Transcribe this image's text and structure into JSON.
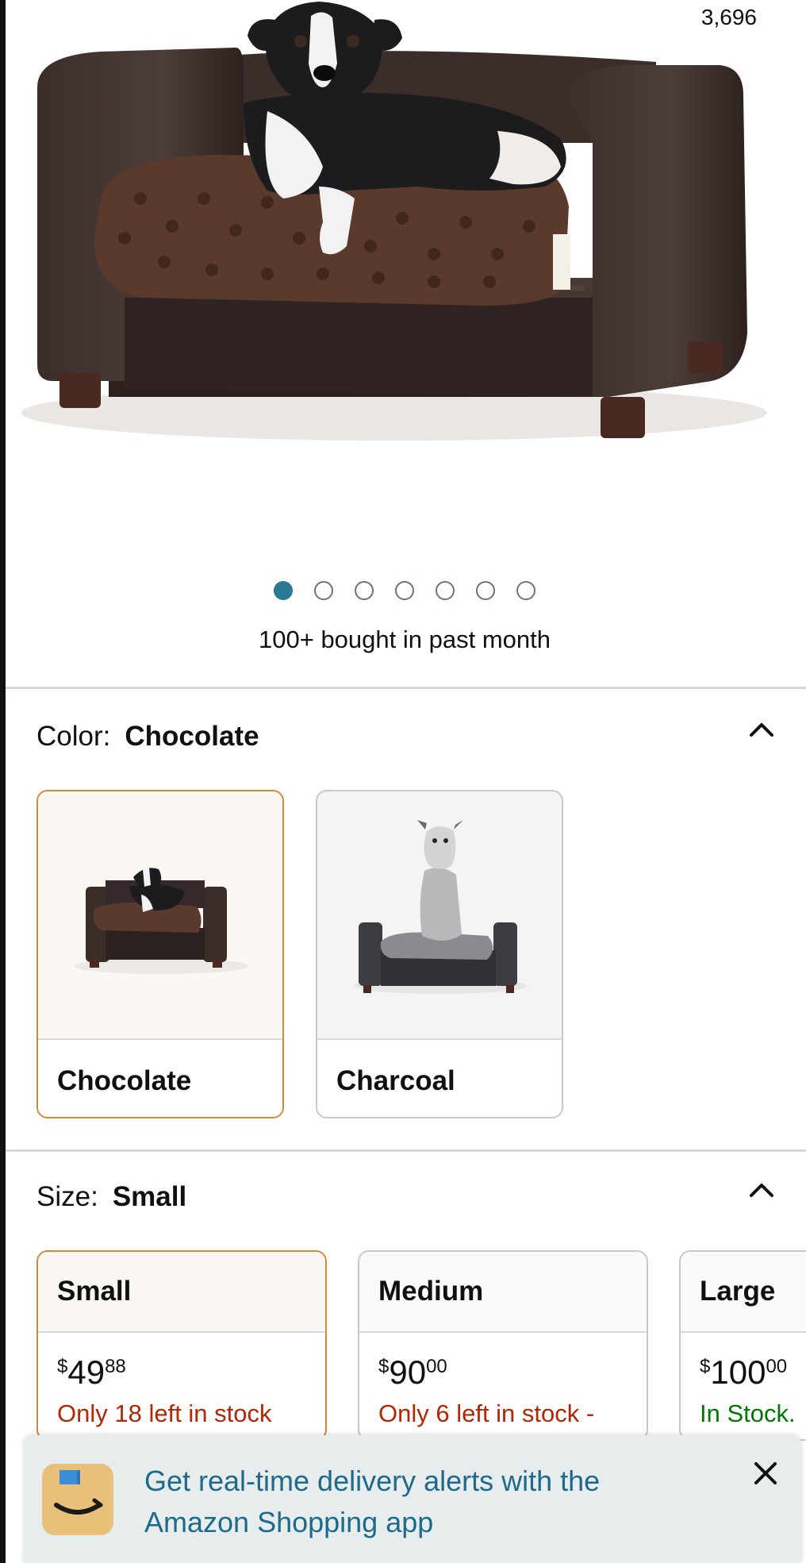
{
  "header": {
    "rating_count": "3,696"
  },
  "gallery": {
    "image_count": 7,
    "active_index": 0,
    "bought_text": "100+ bought in past month"
  },
  "color": {
    "label": "Color:",
    "selected": "Chocolate",
    "options": [
      {
        "name": "Chocolate",
        "selected": true
      },
      {
        "name": "Charcoal",
        "selected": false
      }
    ]
  },
  "size": {
    "label": "Size:",
    "selected": "Small",
    "options": [
      {
        "name": "Small",
        "currency": "$",
        "whole": "49",
        "cents": "88",
        "stock": "Only 18 left in stock",
        "stock_status": "low",
        "selected": true
      },
      {
        "name": "Medium",
        "currency": "$",
        "whole": "90",
        "cents": "00",
        "stock": "Only 6 left in stock -",
        "stock_status": "low",
        "selected": false
      },
      {
        "name": "Large",
        "currency": "$",
        "whole": "100",
        "cents": "00",
        "stock": "In Stock.",
        "stock_status": "ok",
        "selected": false
      }
    ]
  },
  "banner": {
    "message": "Get real-time delivery alerts with the Amazon Shopping app",
    "icon": "amazon-app-icon",
    "close_icon": "close-icon"
  },
  "colors": {
    "accent_selected": "#d08a3b",
    "link": "#1f6a8a",
    "low_stock": "#b12704",
    "in_stock": "#007600",
    "dot_active": "#2c7a92"
  }
}
